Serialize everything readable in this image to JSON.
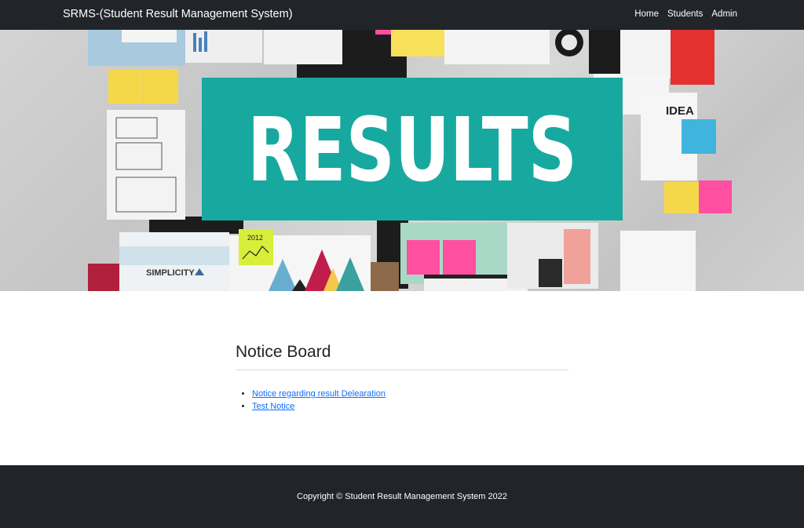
{
  "navbar": {
    "brand": "SRMS-(Student Result Management System)",
    "links": [
      {
        "label": "Home"
      },
      {
        "label": "Students"
      },
      {
        "label": "Admin"
      }
    ]
  },
  "hero": {
    "banner_text": "RESULTS",
    "note_text": "SIMPLICITY",
    "idea_text": "IDEA",
    "sticky_year": "2012",
    "banner_color": "#17a99f"
  },
  "notice_board": {
    "title": "Notice Board",
    "items": [
      {
        "label": "Notice regarding result Delearation"
      },
      {
        "label": "Test Notice"
      }
    ]
  },
  "footer": {
    "copyright": "Copyright © Student Result Management System 2022"
  },
  "colors": {
    "navbar_bg": "#212529",
    "link": "#0d6efd",
    "banner": "#17a99f"
  }
}
